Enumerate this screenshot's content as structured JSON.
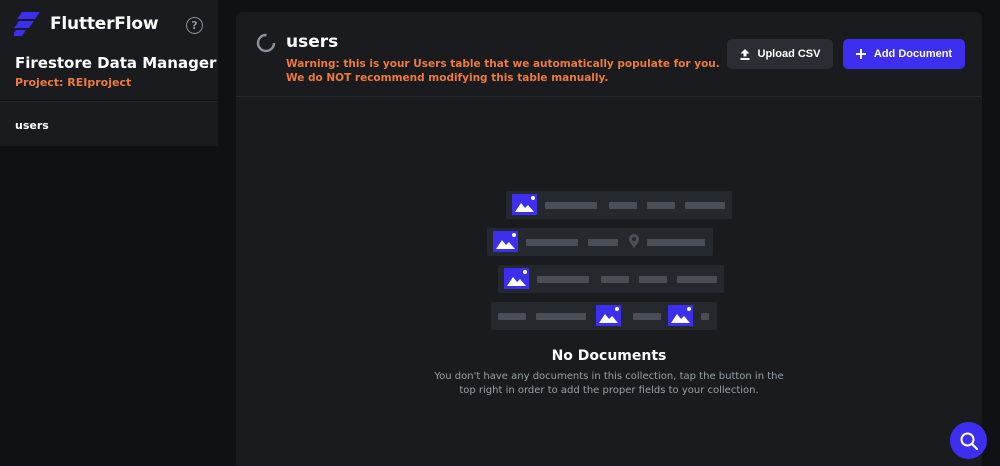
{
  "brand": {
    "name": "FlutterFlow"
  },
  "sidebar": {
    "title": "Firestore Data Manager",
    "project": "Project: REIproject",
    "items": [
      {
        "label": "users"
      }
    ]
  },
  "collection": {
    "title": "users",
    "warning": "Warning: this is your Users table that we automatically populate for you. We do NOT recommend modifying this table manually."
  },
  "toolbar": {
    "upload_label": "Upload CSV",
    "add_label": "Add Document"
  },
  "empty_state": {
    "title": "No Documents",
    "description": "You don't have any documents in this collection, tap the button in the top right in order to add the proper fields to your collection."
  },
  "colors": {
    "accent": "#3d2ff0",
    "warning": "#ef7a3a",
    "background": "#101114",
    "panel": "#191b1f"
  },
  "icons": [
    "flutterflow-logo-icon",
    "help-icon",
    "spinner-icon",
    "upload-icon",
    "plus-icon",
    "image-icon",
    "location-pin-icon",
    "search-icon"
  ]
}
